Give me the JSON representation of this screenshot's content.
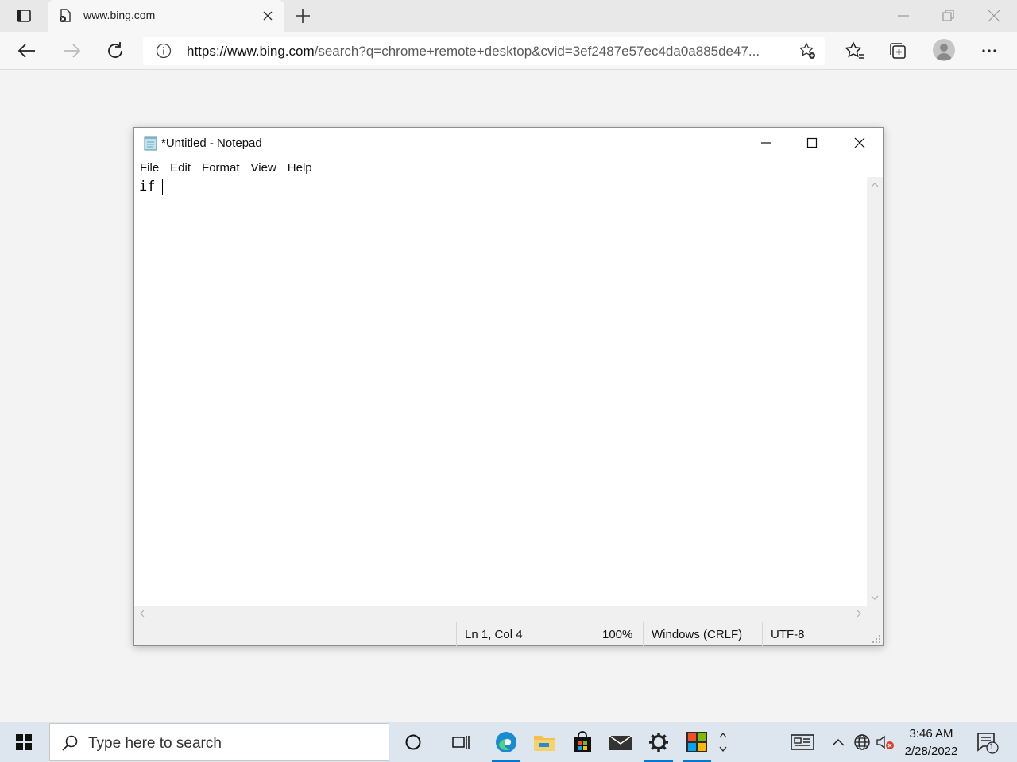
{
  "browser": {
    "tab_title": "www.bing.com",
    "url_host": "https://www.bing.com",
    "url_path": "/search?q=chrome+remote+desktop&cvid=3ef2487e57ec4da0a885de47..."
  },
  "notepad": {
    "title": "*Untitled - Notepad",
    "menu": [
      "File",
      "Edit",
      "Format",
      "View",
      "Help"
    ],
    "content": "if ",
    "status": {
      "position": "Ln 1, Col 4",
      "zoom": "100%",
      "line_ending": "Windows (CRLF)",
      "encoding": "UTF-8"
    }
  },
  "taskbar": {
    "search_placeholder": "Type here to search",
    "time": "3:46 AM",
    "date": "2/28/2022",
    "notification_count": "1"
  },
  "colors": {
    "accent": "#0078d4",
    "taskbar_bg": "#dde6ee"
  }
}
